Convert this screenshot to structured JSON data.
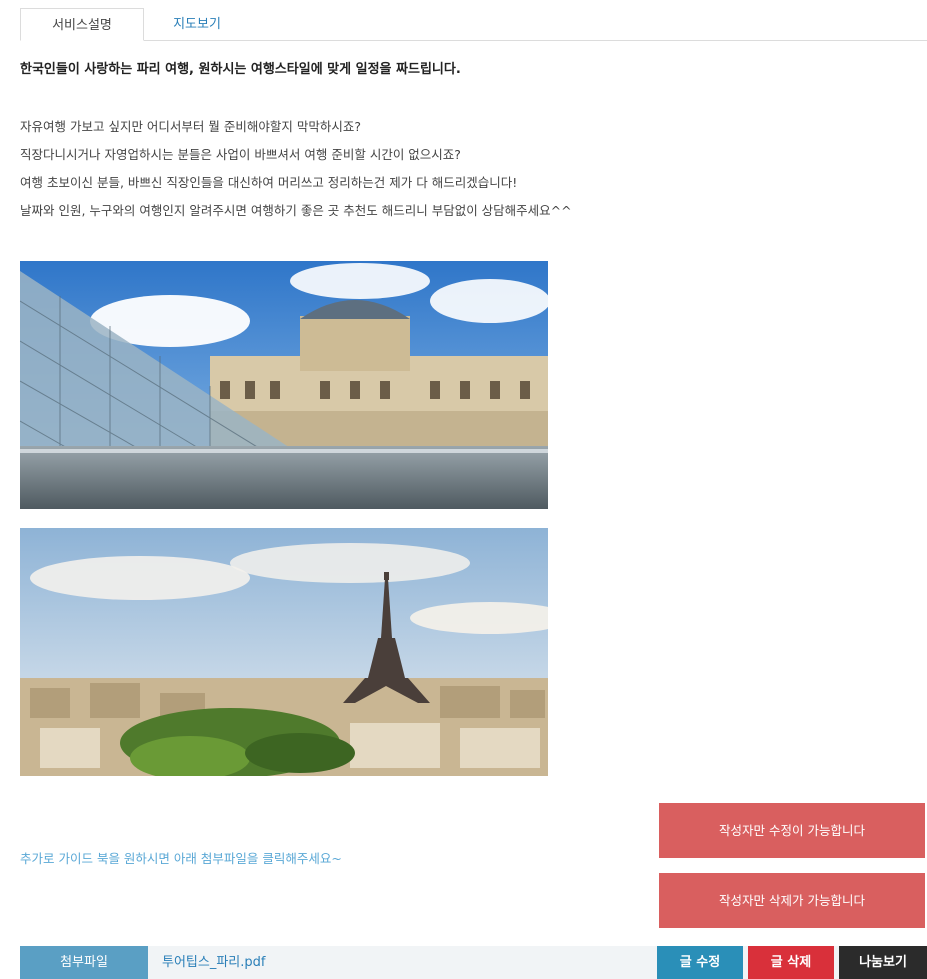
{
  "tabs": {
    "description": "서비스설명",
    "map": "지도보기"
  },
  "content": {
    "headline": "한국인들이 사랑하는 파리 여행, 원하시는 여행스타일에 맞게 일정을 짜드립니다.",
    "paragraphs": [
      "자유여행 가보고 싶지만 어디서부터 뭘 준비해야할지 막막하시죠?",
      "직장다니시거나 자영업하시는 분들은 사업이 바쁘셔서 여행 준비할 시간이 없으시죠?",
      "여행 초보이신 분들, 바쁘신 직장인들을 대신하여 머리쓰고 정리하는건 제가 다 해드리겠습니다!",
      "날짜와 인원, 누구와의 여행인지 알려주시면 여행하기 좋은 곳 추천도 해드리니 부담없이 상담해주세요^^"
    ],
    "guide_text": "추가로 가이드 북을 원하시면 아래 첨부파일을 클릭해주세요~"
  },
  "notices": {
    "edit_only": "작성자만 수정이 가능합니다",
    "delete_only": "작성자만 삭제가 가능합니다"
  },
  "attachment": {
    "label": "첨부파일",
    "filename": "투어팁스_파리.pdf"
  },
  "actions": {
    "edit": "글 수정",
    "delete": "글 삭제",
    "share": "나눔보기"
  },
  "colors": {
    "link_blue": "#2a7fb8",
    "notice_red": "#d95f5f",
    "delete_red": "#d9303a",
    "share_dark": "#2b2b2b"
  }
}
